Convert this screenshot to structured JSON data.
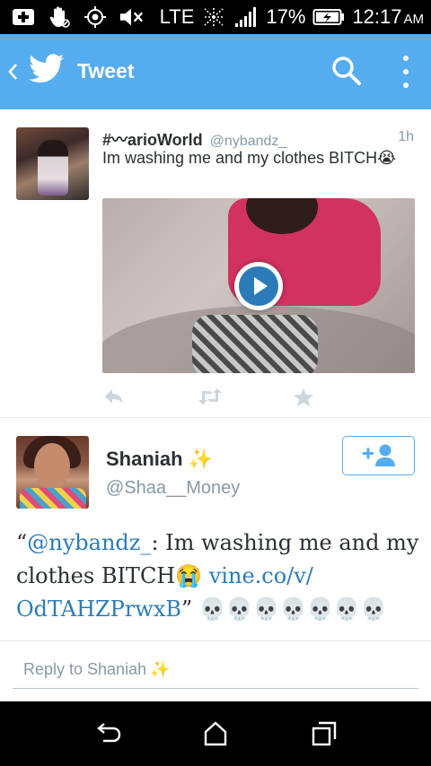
{
  "status_bar": {
    "network": "LTE",
    "battery": "17%",
    "time": "12:17",
    "ampm": "AM"
  },
  "app_bar": {
    "title": "Tweet"
  },
  "original_tweet": {
    "name": "#〰arioWorld",
    "handle": "@nybandz_",
    "time": "1h",
    "text": "Im washing me and my clothes BITCH😭"
  },
  "retweet": {
    "name": "Shaniah",
    "name_emoji": "✨",
    "handle": "@Shaa__Money",
    "text_open": "“",
    "mention": "@nybandz_",
    "text_mid": ": Im washing me and my clothes BITCH😭 ",
    "link": "vine.co/v/ OdTAHZPrwxB",
    "text_close": "” 💀💀💀💀💀💀💀"
  },
  "reply": {
    "placeholder": "Reply to Shaniah",
    "emoji": "✨"
  },
  "colors": {
    "app_bar": "#55acee",
    "link": "#2b7bb9",
    "secondary_text": "#8899a6"
  },
  "icons": {
    "status_bar": [
      "add-icon",
      "hand-icon",
      "gps-icon",
      "mute-icon",
      "signal-icon",
      "battery-icon"
    ],
    "app_bar": [
      "back-chevron-icon",
      "twitter-bird-icon",
      "search-icon",
      "more-icon"
    ],
    "tweet_actions": [
      "reply-icon",
      "retweet-icon",
      "favorite-icon"
    ],
    "nav": [
      "back-icon",
      "home-icon",
      "recent-apps-icon"
    ]
  }
}
